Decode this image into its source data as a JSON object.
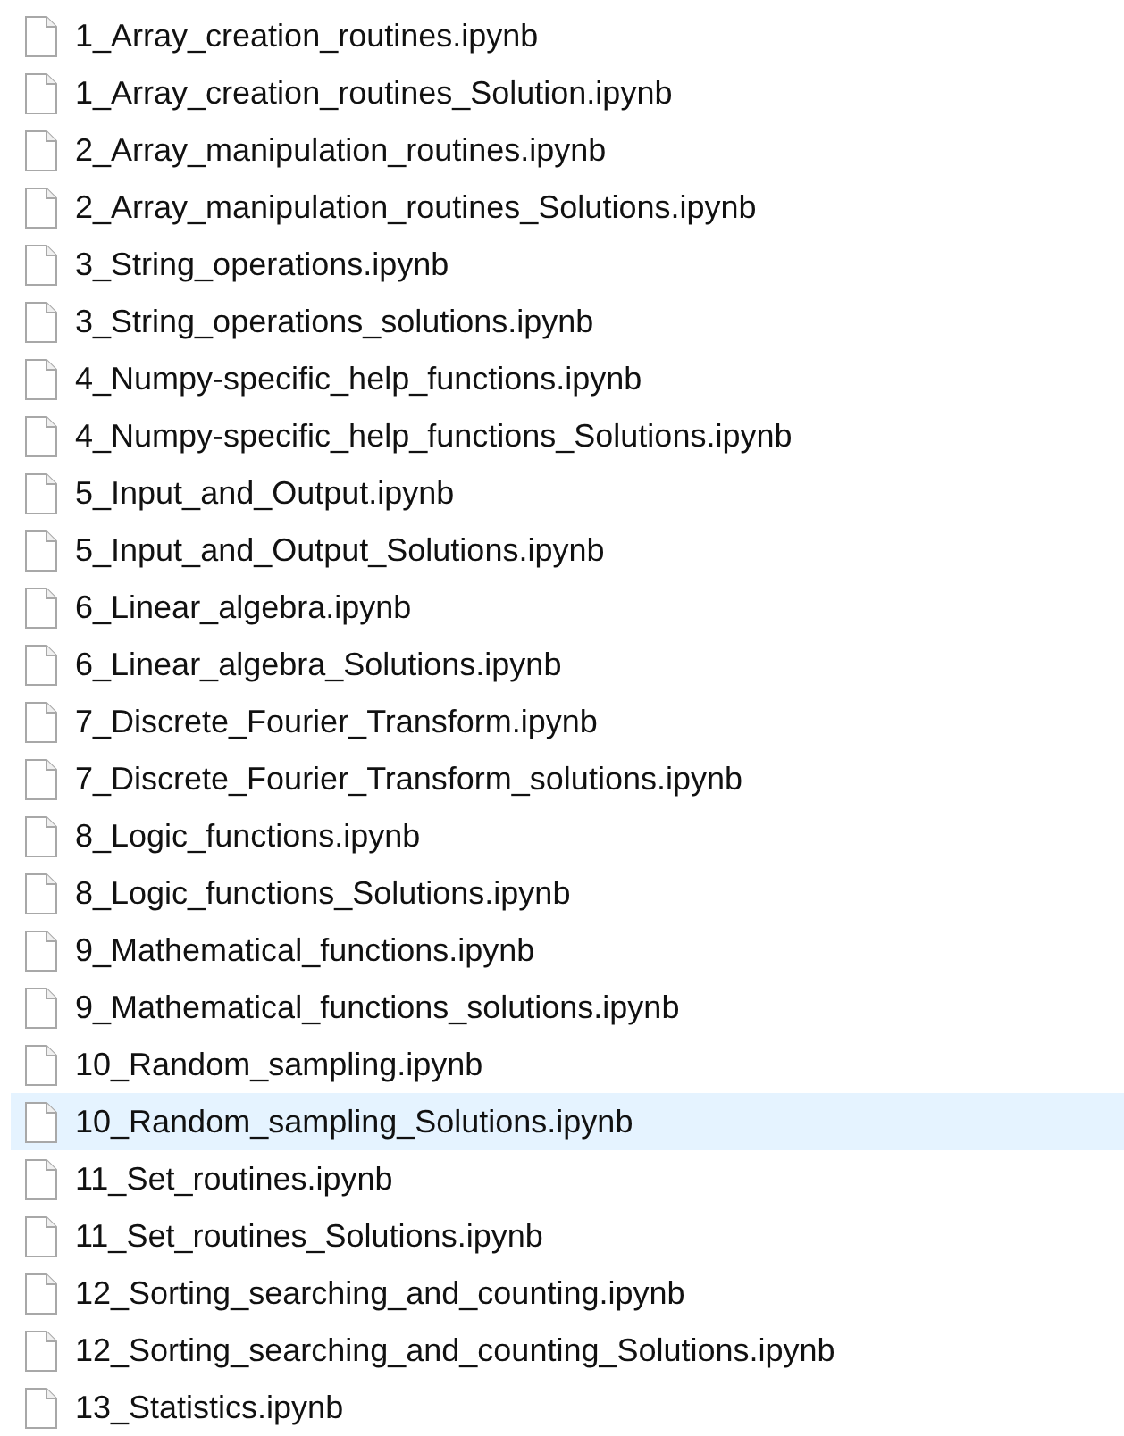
{
  "files": [
    {
      "name": "1_Array_creation_routines.ipynb",
      "selected": false
    },
    {
      "name": "1_Array_creation_routines_Solution.ipynb",
      "selected": false
    },
    {
      "name": "2_Array_manipulation_routines.ipynb",
      "selected": false
    },
    {
      "name": "2_Array_manipulation_routines_Solutions.ipynb",
      "selected": false
    },
    {
      "name": "3_String_operations.ipynb",
      "selected": false
    },
    {
      "name": "3_String_operations_solutions.ipynb",
      "selected": false
    },
    {
      "name": "4_Numpy-specific_help_functions.ipynb",
      "selected": false
    },
    {
      "name": "4_Numpy-specific_help_functions_Solutions.ipynb",
      "selected": false
    },
    {
      "name": "5_Input_and_Output.ipynb",
      "selected": false
    },
    {
      "name": "5_Input_and_Output_Solutions.ipynb",
      "selected": false
    },
    {
      "name": "6_Linear_algebra.ipynb",
      "selected": false
    },
    {
      "name": "6_Linear_algebra_Solutions.ipynb",
      "selected": false
    },
    {
      "name": "7_Discrete_Fourier_Transform.ipynb",
      "selected": false
    },
    {
      "name": "7_Discrete_Fourier_Transform_solutions.ipynb",
      "selected": false
    },
    {
      "name": "8_Logic_functions.ipynb",
      "selected": false
    },
    {
      "name": "8_Logic_functions_Solutions.ipynb",
      "selected": false
    },
    {
      "name": "9_Mathematical_functions.ipynb",
      "selected": false
    },
    {
      "name": "9_Mathematical_functions_solutions.ipynb",
      "selected": false
    },
    {
      "name": "10_Random_sampling.ipynb",
      "selected": false
    },
    {
      "name": "10_Random_sampling_Solutions.ipynb",
      "selected": true
    },
    {
      "name": "11_Set_routines.ipynb",
      "selected": false
    },
    {
      "name": "11_Set_routines_Solutions.ipynb",
      "selected": false
    },
    {
      "name": "12_Sorting_searching_and_counting.ipynb",
      "selected": false
    },
    {
      "name": "12_Sorting_searching_and_counting_Solutions.ipynb",
      "selected": false
    },
    {
      "name": "13_Statistics.ipynb",
      "selected": false
    }
  ]
}
